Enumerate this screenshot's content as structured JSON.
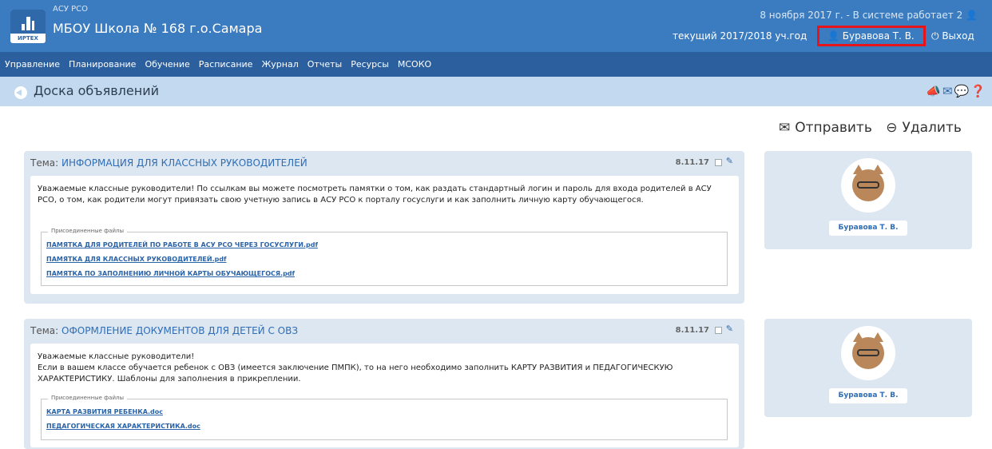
{
  "header": {
    "logo_text": "ИРТЕХ",
    "app_name": "АСУ РСО",
    "school_name": "МБОУ Школа № 168 г.о.Самара",
    "date_status": "8 ноября 2017 г. - В системе работает 2",
    "academic_year": "текущий 2017/2018 уч.год",
    "user_name": "Буравова Т. В.",
    "logout_label": "Выход"
  },
  "nav": {
    "items": [
      "Управление",
      "Планирование",
      "Обучение",
      "Расписание",
      "Журнал",
      "Отчеты",
      "Ресурсы",
      "МСОКО"
    ]
  },
  "page": {
    "title": "Доска объявлений",
    "send_label": "Отправить",
    "delete_label": "Удалить"
  },
  "announcements": [
    {
      "topic_prefix": "Тема:",
      "topic": "ИНФОРМАЦИЯ ДЛЯ КЛАССНЫХ РУКОВОДИТЕЛЕЙ",
      "date": "8.11.17",
      "text": "Уважаемые классные руководители! По ссылкам вы можете посмотреть памятки о том, как раздать стандартный логин и пароль для входа родителей в АСУ РСО, о том, как родители могут привязать свою учетную запись в АСУ РСО к порталу госуслуги и как заполнить личную карту обучающегося.",
      "files_label": "Присоединенные файлы",
      "files": [
        "ПАМЯТКА ДЛЯ РОДИТЕЛЕЙ ПО РАБОТЕ В АСУ РСО ЧЕРЕЗ ГОСУСЛУГИ.pdf",
        "ПАМЯТКА ДЛЯ КЛАССНЫХ РУКОВОДИТЕЛЕЙ.pdf",
        "ПАМЯТКА ПО ЗАПОЛНЕНИЮ ЛИЧНОЙ КАРТЫ ОБУЧАЮЩЕГОСЯ.pdf"
      ],
      "author": "Буравова Т. В."
    },
    {
      "topic_prefix": "Тема:",
      "topic": "ОФОРМЛЕНИЕ ДОКУМЕНТОВ ДЛЯ ДЕТЕЙ С ОВЗ",
      "date": "8.11.17",
      "text_lines": [
        "Уважаемые классные руководители!",
        "Если в вашем классе обучается ребенок с ОВЗ (имеется заключение ПМПК), то на него необходимо заполнить КАРТУ РАЗВИТИЯ и ПЕДАГОГИЧЕСКУЮ ХАРАКТЕРИСТИКУ. Шаблоны для заполнения в прикреплении."
      ],
      "files_label": "Присоединенные файлы",
      "files": [
        "КАРТА РАЗВИТИЯ РЕБЕНКА.doc",
        "ПЕДАГОГИЧЕСКАЯ ХАРАКТЕРИСТИКА.doc"
      ],
      "author": "Буравова Т. В."
    }
  ],
  "colors": {
    "header_bg": "#3b7bbf",
    "nav_bg": "#2b5f9e",
    "subbar_bg": "#c3d9ef",
    "card_bg": "#dde7f1",
    "link": "#2a63a8",
    "highlight": "#e8141b"
  },
  "icons": {
    "back": "back-arrow-icon",
    "megaphone": "megaphone-icon",
    "mail": "envelope-icon",
    "chat": "chat-icon",
    "help": "help-icon",
    "user": "user-icon",
    "power": "power-icon",
    "send": "envelope-icon",
    "delete": "minus-circle-icon",
    "edit": "pencil-icon"
  }
}
